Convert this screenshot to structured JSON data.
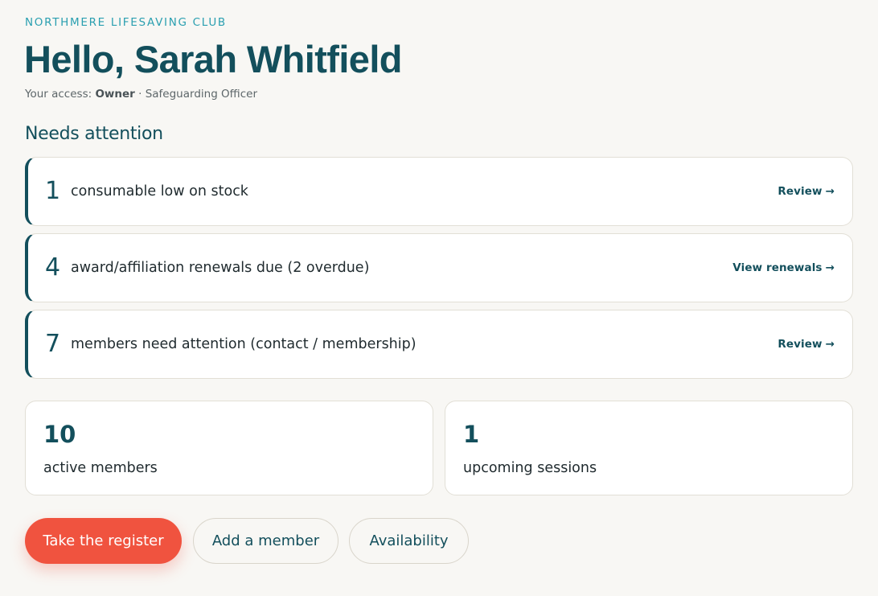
{
  "header": {
    "club_name": "NORTHMERE LIFESAVING CLUB",
    "greeting": "Hello, Sarah Whitfield",
    "access_prefix": "Your access: ",
    "access_role": "Owner",
    "access_suffix": " · Safeguarding Officer"
  },
  "attention": {
    "title": "Needs attention",
    "items": [
      {
        "count": "1",
        "text": "consumable low on stock",
        "action": "Review"
      },
      {
        "count": "4",
        "text": "award/affiliation renewals due (2 overdue)",
        "action": "View renewals"
      },
      {
        "count": "7",
        "text": "members need attention (contact / membership)",
        "action": "Review"
      }
    ],
    "arrow_glyph": "→"
  },
  "stats": [
    {
      "value": "10",
      "label": "active members"
    },
    {
      "value": "1",
      "label": "upcoming sessions"
    }
  ],
  "actions": {
    "take_register": "Take the register",
    "add_member": "Add a member",
    "availability": "Availability"
  },
  "colors": {
    "brand_teal": "#134f5c",
    "eyebrow_teal": "#2a9fb0",
    "primary_coral": "#f0533f",
    "background": "#f8f7f4"
  }
}
